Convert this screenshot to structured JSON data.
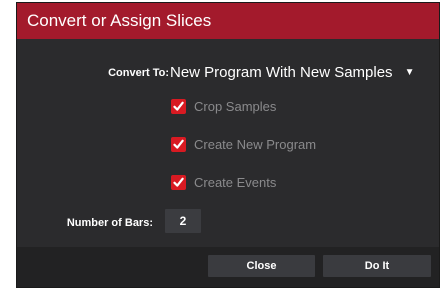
{
  "dialog": {
    "title": "Convert or Assign Slices",
    "convert_to": {
      "label": "Convert To:",
      "selected": "New Program With New Samples"
    },
    "options": [
      {
        "label": "Crop Samples",
        "checked": true
      },
      {
        "label": "Create New Program",
        "checked": true
      },
      {
        "label": "Create Events",
        "checked": true
      }
    ],
    "number_of_bars": {
      "label": "Number of Bars:",
      "value": "2"
    },
    "buttons": {
      "close": "Close",
      "do_it": "Do It"
    }
  },
  "colors": {
    "title_bar": "#a31a2c",
    "dialog_bg": "#2b2b2d",
    "checkbox": "#d81a22",
    "button_bg": "#3a3b3f"
  }
}
